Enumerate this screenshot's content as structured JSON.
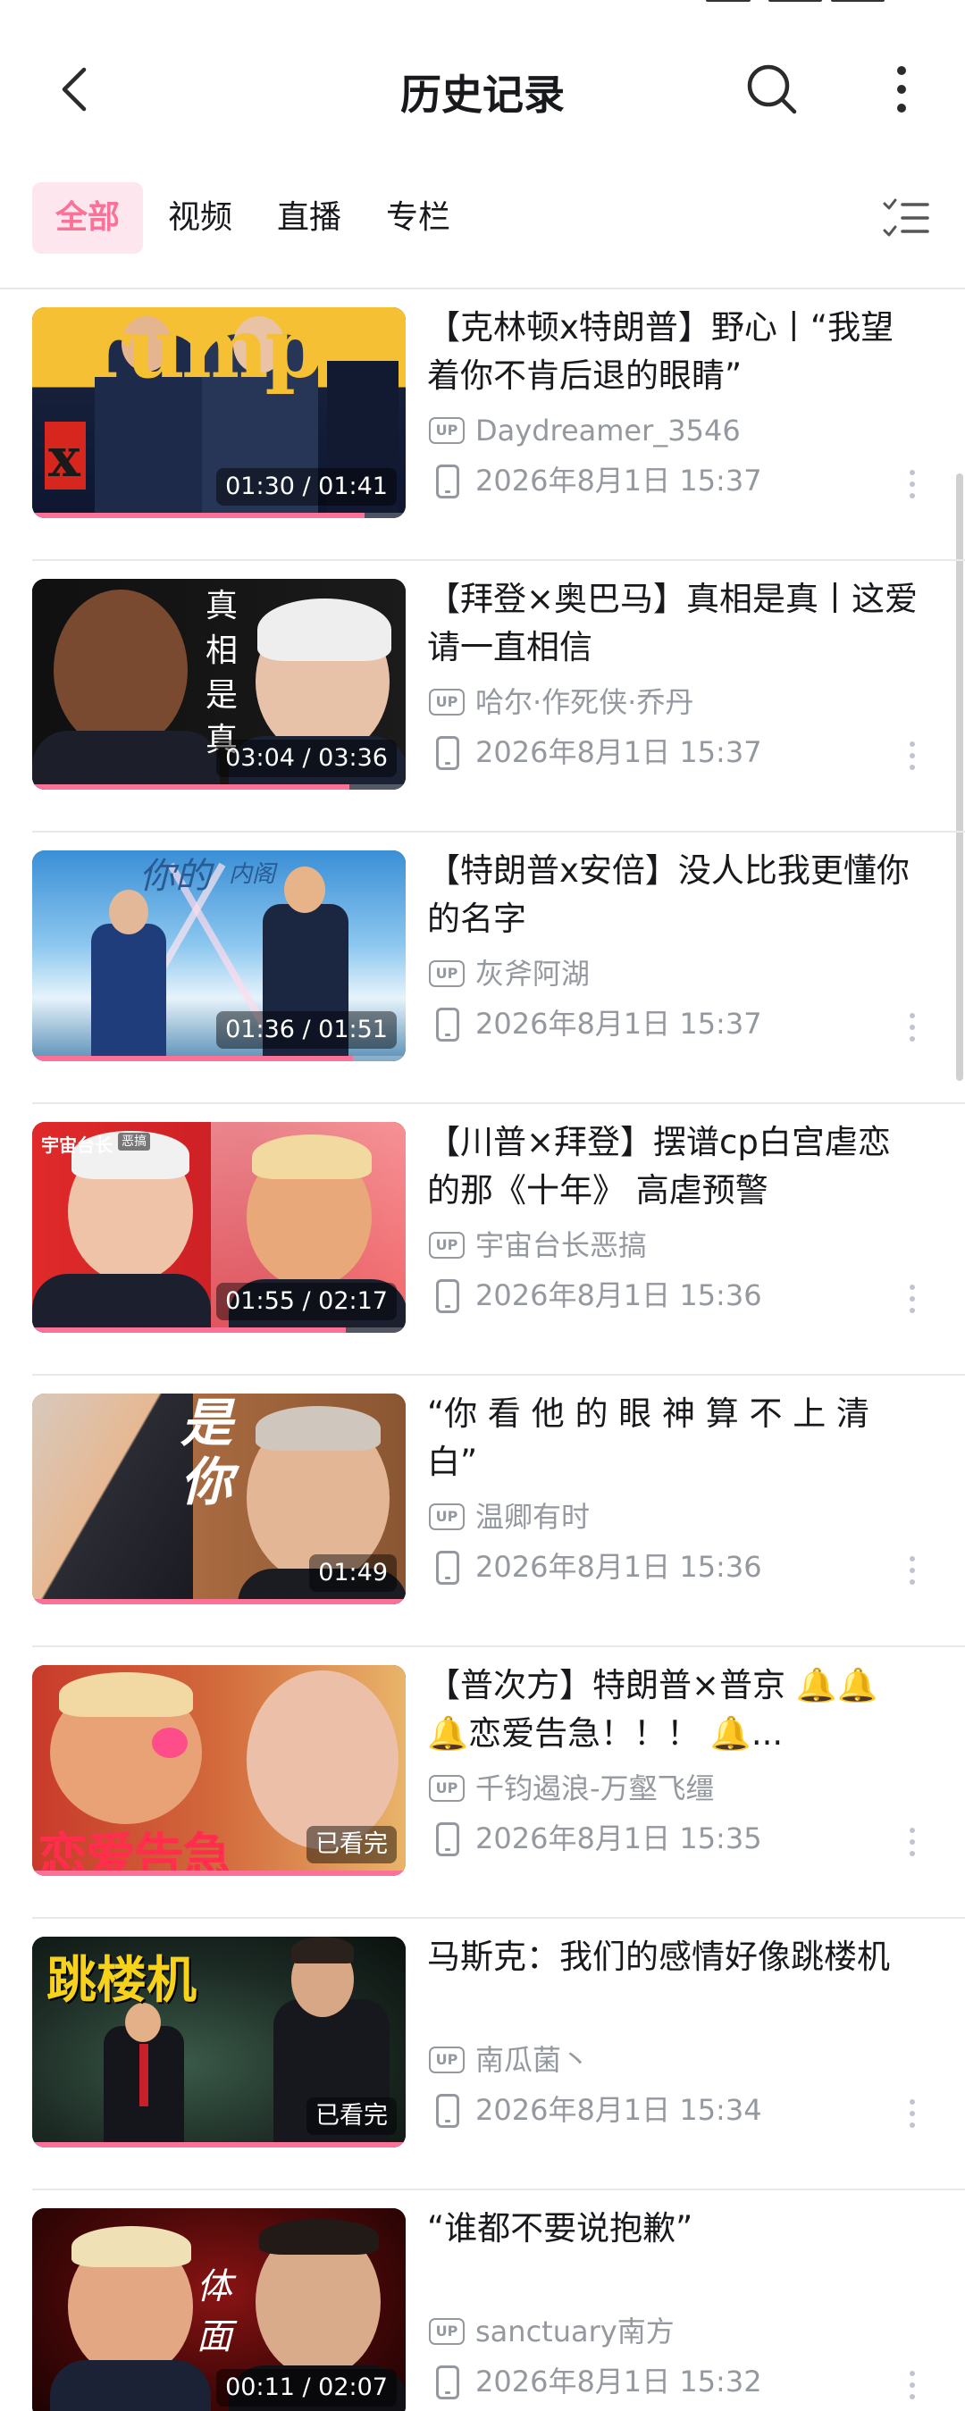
{
  "header": {
    "title": "历史记录",
    "back_icon": "chevron-left-icon",
    "search_icon": "search-icon",
    "more_icon": "more-vertical-icon"
  },
  "tabs": [
    {
      "label": "全部",
      "active": true
    },
    {
      "label": "视频",
      "active": false
    },
    {
      "label": "直播",
      "active": false
    },
    {
      "label": "专栏",
      "active": false
    }
  ],
  "colors": {
    "accent": "#fb7299",
    "accent_bg": "#fde6ee",
    "meta": "#9499a0",
    "text": "#18191c"
  },
  "items": [
    {
      "title": "【克林顿x特朗普】野心丨“我望着你不肯后退的眼睛”",
      "up": "Daydreamer_3546",
      "time": "2026年8月1日 15:37",
      "duration": "01:30 / 01:41",
      "progress": 0.89
    },
    {
      "title": "【拜登×奥巴马】真相是真丨这爱请一直相信",
      "up": "哈尔·作死侠·乔丹",
      "time": "2026年8月1日 15:37",
      "duration": "03:04 / 03:36",
      "progress": 0.85
    },
    {
      "title": "【特朗普x安倍】没人比我更懂你的名字",
      "up": "灰斧阿湖",
      "time": "2026年8月1日 15:37",
      "duration": "01:36 / 01:51",
      "progress": 0.86
    },
    {
      "title": "【川普×拜登】摆谱cp白宫虐恋的那《十年》 高虐预警",
      "up": "宇宙台长恶搞",
      "time": "2026年8月1日 15:36",
      "duration": "01:55 / 02:17",
      "progress": 0.84
    },
    {
      "title": "“你 看 他 的 眼 神 算 不 上 清 白”",
      "up": "温卿有时",
      "time": "2026年8月1日 15:36",
      "duration": "01:49",
      "progress": 1.0
    },
    {
      "title": "【普次方】特朗普×普京 🔔🔔🔔恋爱告急！！！ 🔔...",
      "up": "千钧遏浪-万壑飞缰",
      "time": "2026年8月1日 15:35",
      "duration": "已看完",
      "progress": 1.0
    },
    {
      "title": "马斯克：我们的感情好像跳楼机",
      "up": "南瓜菌丶",
      "time": "2026年8月1日 15:34",
      "duration": "已看完",
      "progress": 1.0
    },
    {
      "title": "“谁都不要说抱歉”",
      "up": "sanctuary南方",
      "time": "2026年8月1日 15:32",
      "duration": "00:11 / 02:07",
      "progress": 0.09
    }
  ],
  "thumb_text": {
    "t1a": "Trump",
    "t1b": "x",
    "t2": "真相是真",
    "t3a": "你的",
    "t3b": "内阁",
    "t4a": "宇宙台长",
    "t4b": "恶搞",
    "t5": "是你",
    "t6": "恋爱告急",
    "t7": "跳楼机",
    "t8": "体面"
  }
}
